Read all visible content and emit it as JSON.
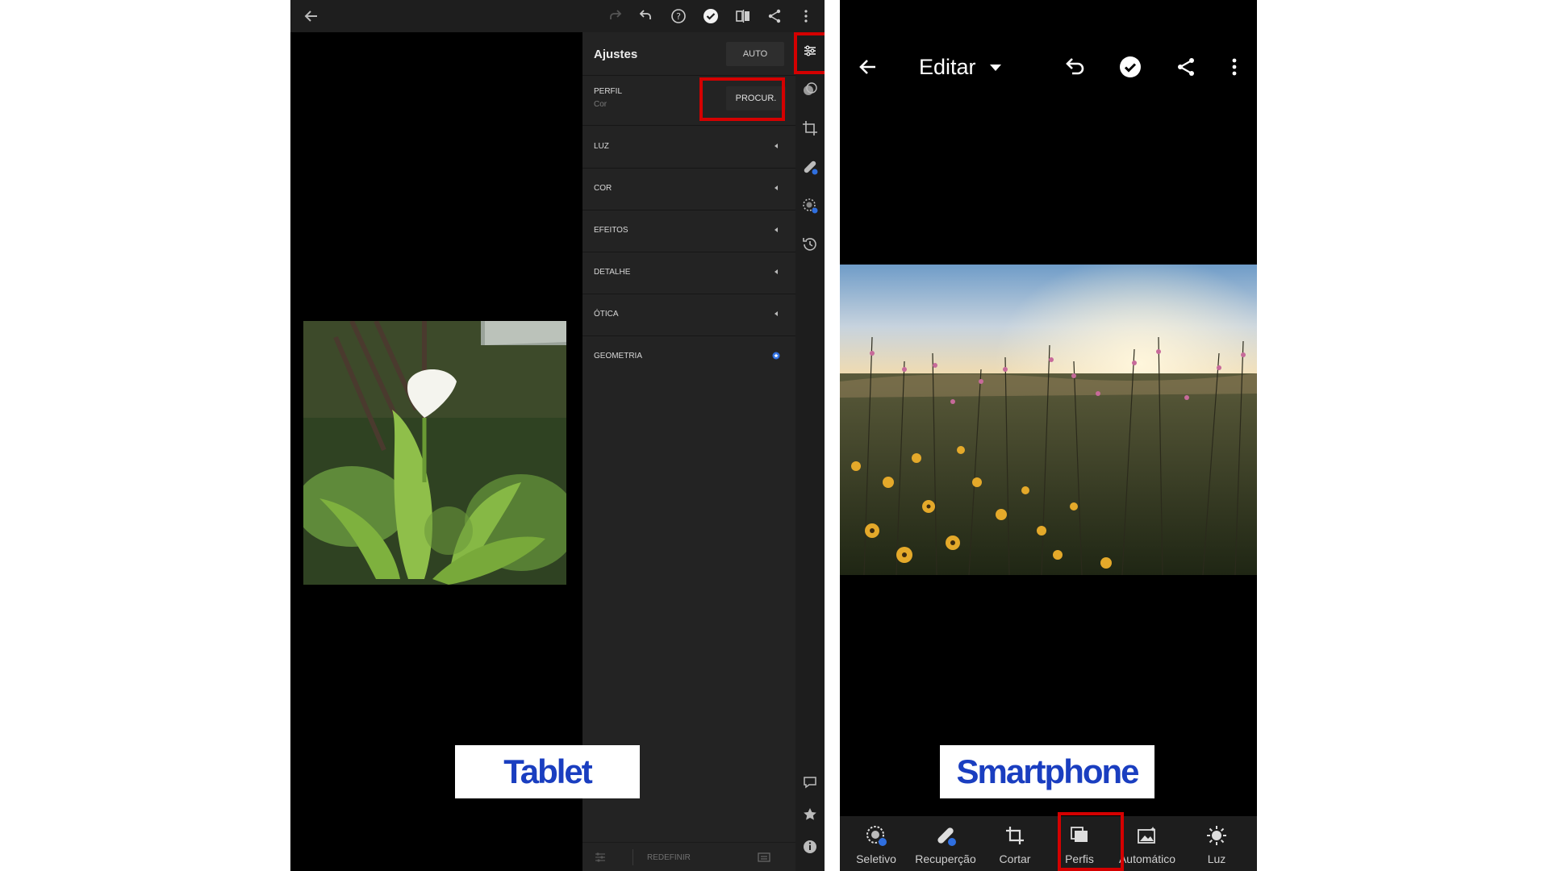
{
  "tablet": {
    "panel_title": "Ajustes",
    "auto_label": "AUTO",
    "perfil_label": "PERFIL",
    "perfil_value": "Cor",
    "procurar_label": "PROCUR.",
    "sections": [
      {
        "label": "LUZ",
        "indicator": "arrow"
      },
      {
        "label": "COR",
        "indicator": "arrow"
      },
      {
        "label": "EFEITOS",
        "indicator": "arrow"
      },
      {
        "label": "DETALHE",
        "indicator": "arrow"
      },
      {
        "label": "ÓTICA",
        "indicator": "arrow"
      },
      {
        "label": "GEOMETRIA",
        "indicator": "premium-star"
      }
    ],
    "reset_label": "REDEFINIR",
    "toolbar_icons": [
      "back-arrow-icon",
      "redo-icon",
      "undo-icon",
      "help-icon",
      "done-check-icon",
      "compare-icon",
      "share-icon",
      "more-icon"
    ],
    "side_icons": [
      "adjustments-icon",
      "presets-icon",
      "crop-icon",
      "healing-icon",
      "selective-icon",
      "history-icon",
      "comment-icon",
      "star-icon",
      "info-icon"
    ],
    "badge_text": "Tablet"
  },
  "phone": {
    "title": "Editar",
    "toolbar_icons": [
      "back-arrow-icon",
      "dropdown-caret-icon",
      "undo-icon",
      "done-check-icon",
      "share-icon",
      "more-icon"
    ],
    "tools": [
      {
        "label": "Seletivo",
        "icon": "selective-icon"
      },
      {
        "label": "Recuperção",
        "icon": "healing-icon"
      },
      {
        "label": "Cortar",
        "icon": "crop-icon"
      },
      {
        "label": "Perfis",
        "icon": "profiles-icon"
      },
      {
        "label": "Automático",
        "icon": "auto-icon"
      },
      {
        "label": "Luz",
        "icon": "light-icon"
      }
    ],
    "badge_text": "Smartphone"
  },
  "colors": {
    "highlight": "#d40000",
    "premium_blue": "#2f6fe0",
    "badge_text": "#1a3ec0"
  }
}
